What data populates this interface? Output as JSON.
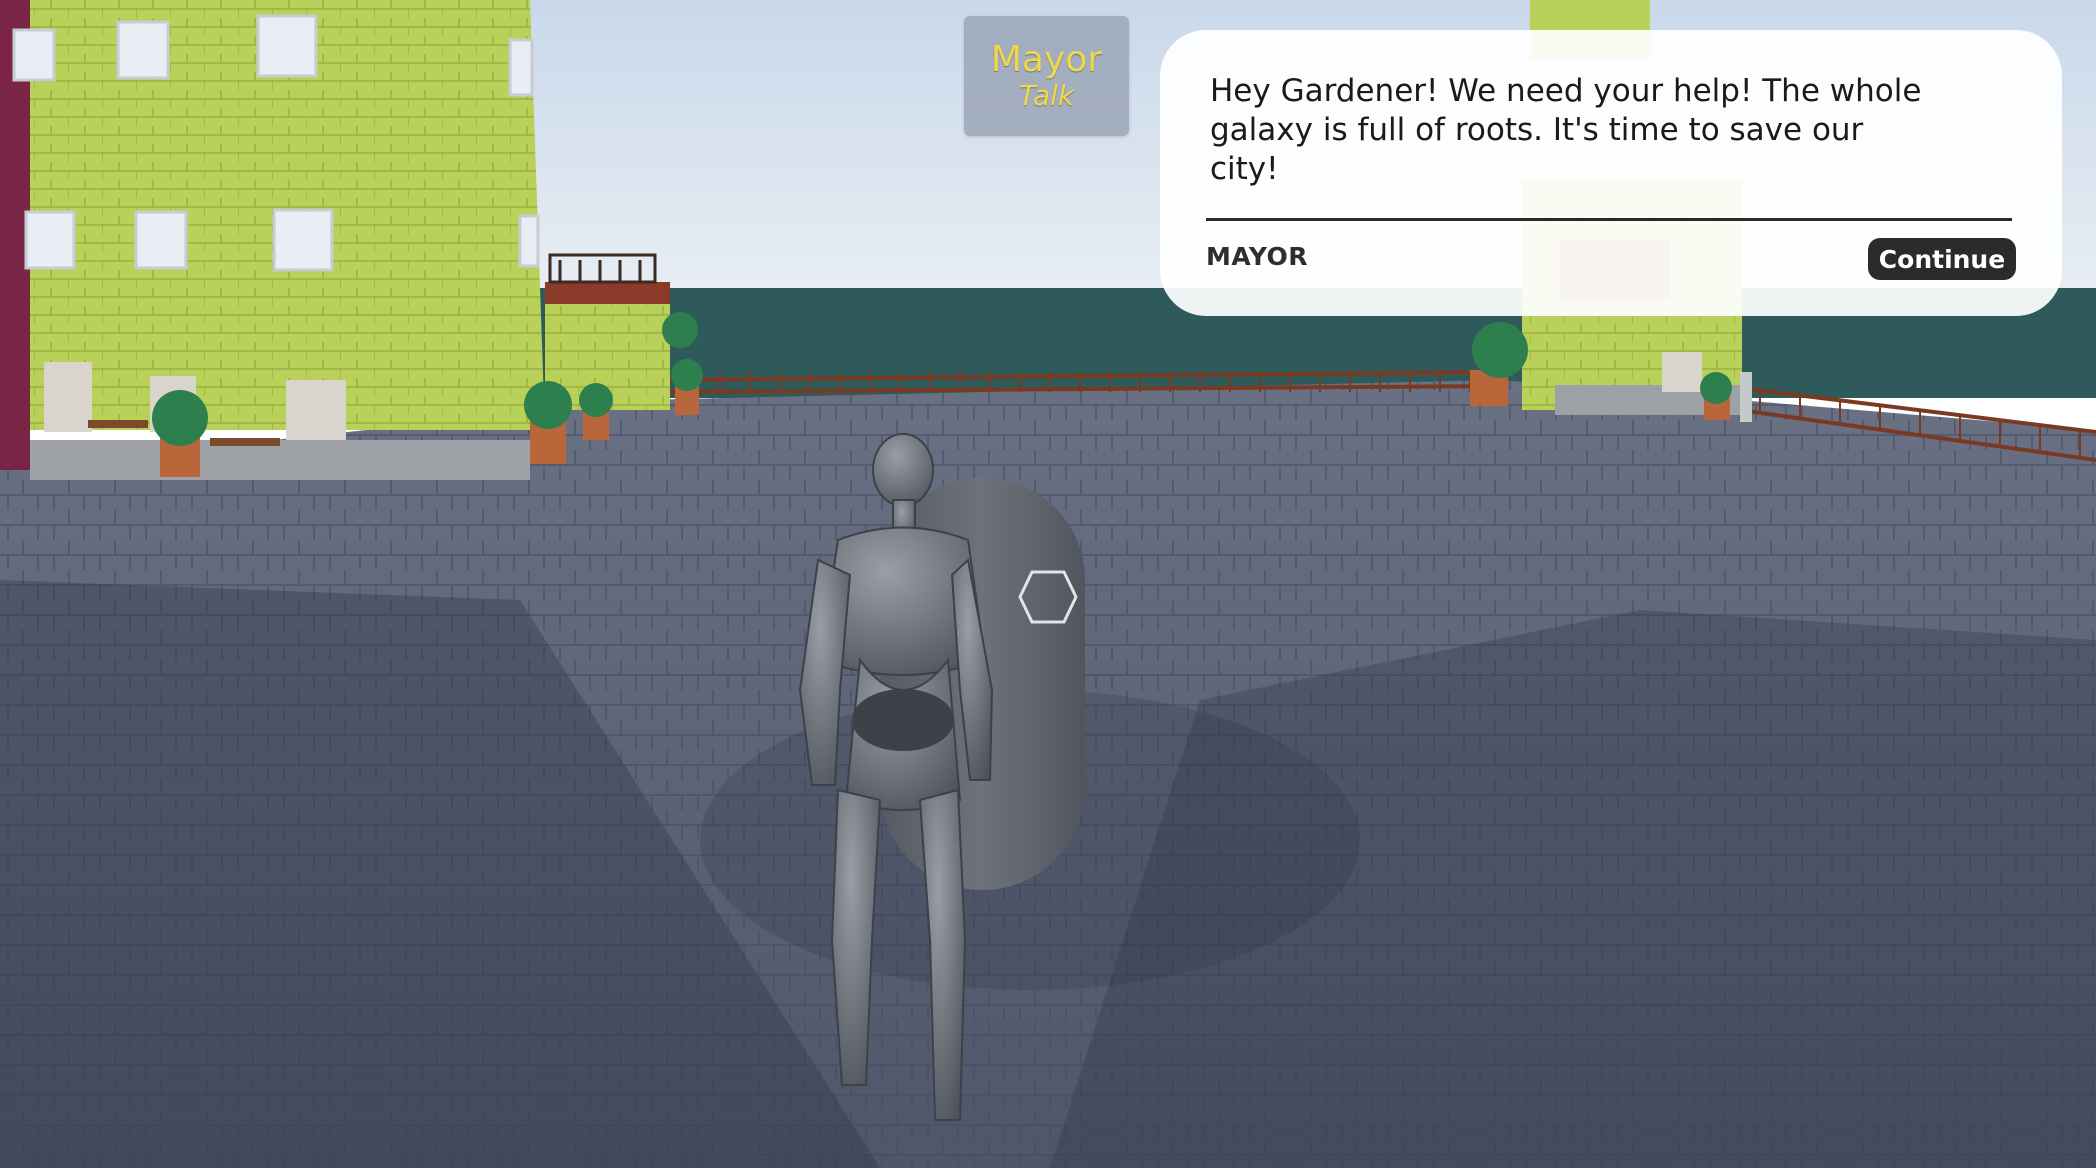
{
  "nameplate": {
    "name": "Mayor",
    "action": "Talk"
  },
  "dialogue": {
    "text": "Hey Gardener! We need your help! The whole galaxy is full of roots. It's time to save our city!",
    "speaker": "MAYOR",
    "continue_label": "Continue"
  },
  "colors": {
    "sky": "#d6e2ef",
    "sea": "#2f5a5c",
    "plaza": "#5c6478",
    "building": "#b9d158",
    "nameplate_text": "#f0d84a",
    "button": "#2b2b2b"
  },
  "icons": {
    "interaction_marker": "hexagon-icon"
  }
}
